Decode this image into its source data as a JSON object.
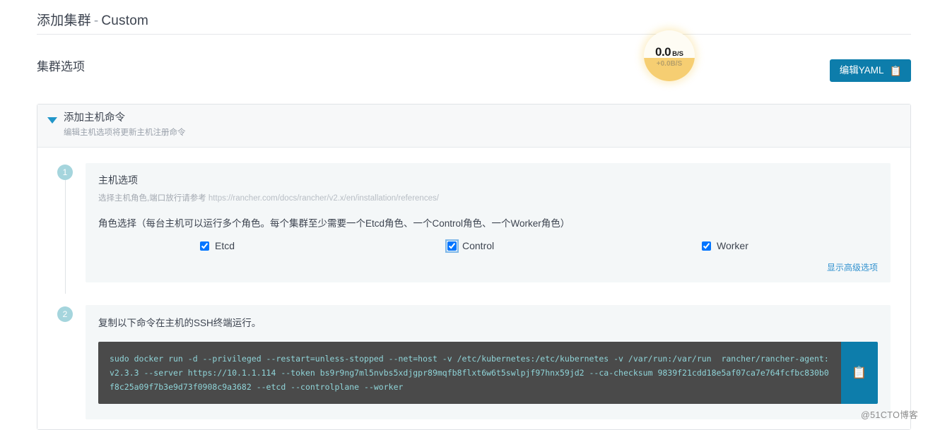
{
  "header": {
    "title_main": "添加集群",
    "separator": "-",
    "title_suffix": "Custom"
  },
  "options_section": {
    "title": "集群选项",
    "yaml_button_label": "编辑YAML",
    "yaml_button_icon": "clipboard-icon"
  },
  "net_widget": {
    "value": "0.0",
    "unit": "B/S",
    "delta": "+0.0B/S",
    "fill_color": "#f4c55b",
    "background_color": "#fefcf4"
  },
  "panel": {
    "caret_icon": "chevron-down-icon",
    "title": "添加主机命令",
    "subtitle": "编辑主机选项将更新主机注册命令"
  },
  "step1": {
    "number": "1",
    "title": "主机选项",
    "subtitle_text": "选择主机角色,端口放行请参考",
    "subtitle_url": "https://rancher.com/docs/rancher/v2.x/en/installation/references/",
    "roles_label": "角色选择（每台主机可以运行多个角色。每个集群至少需要一个Etcd角色、一个Control角色、一个Worker角色）",
    "roles": [
      {
        "label": "Etcd",
        "checked": true,
        "focused": false
      },
      {
        "label": "Control",
        "checked": true,
        "focused": true
      },
      {
        "label": "Worker",
        "checked": true,
        "focused": false
      }
    ],
    "advanced_link": "显示高级选项"
  },
  "step2": {
    "number": "2",
    "title": "复制以下命令在主机的SSH终端运行。",
    "command": "sudo docker run -d --privileged --restart=unless-stopped --net=host -v /etc/kubernetes:/etc/kubernetes -v /var/run:/var/run  rancher/rancher-agent:v2.3.3 --server https://10.1.1.114 --token bs9r9ng7ml5nvbs5xdjgpr89mqfb8flxt6w6t5swlpjf97hnx59jd2 --ca-checksum 9839f21cdd18e5af07ca7e764fcfbc830b0f8c25a09f7b3e9d73f0908c9a3682 --etcd --controlplane --worker",
    "copy_icon": "clipboard-icon"
  },
  "watermark": "@51CTO博客",
  "colors": {
    "accent_blue": "#0d7dab",
    "link_blue": "#3292cf",
    "step_badge": "#a5d5dd",
    "terminal_bg": "#4a4a4a",
    "terminal_text": "#8fd4d8"
  }
}
